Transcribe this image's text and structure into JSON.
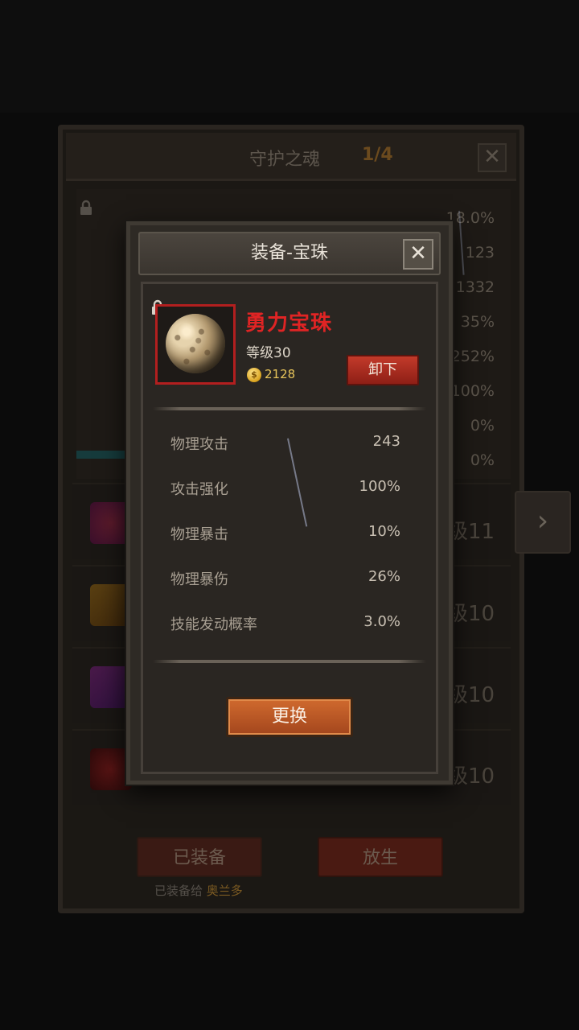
{
  "background": {
    "title": "守护之魂",
    "counter": "1/4",
    "stat_values": [
      "18.0%",
      "123",
      "1332",
      "35%",
      "252%",
      "100%",
      "0%",
      "0%"
    ],
    "slot_levels": [
      "级11",
      "级10",
      "级10",
      "级10"
    ],
    "equipped_button": "已装备",
    "release_button": "放生",
    "equipped_note": "已装备给",
    "equipped_hero": "奥兰多"
  },
  "modal": {
    "title": "装备-宝珠",
    "item": {
      "name": "勇力宝珠",
      "level": "等级30",
      "price": "2128",
      "unequip_label": "卸下"
    },
    "stats": [
      {
        "name": "物理攻击",
        "value": "243"
      },
      {
        "name": "攻击强化",
        "value": "100%"
      },
      {
        "name": "物理暴击",
        "value": "10%"
      },
      {
        "name": "物理暴伤",
        "value": "26%"
      },
      {
        "name": "技能发动概率",
        "value": "3.0%"
      }
    ],
    "replace_label": "更换"
  },
  "colors": {
    "item_name": "#e02424",
    "frame_border": "#b21f1f",
    "unequip_button": "#c23a2a",
    "replace_button": "#d06a2e",
    "price": "#e7c45a"
  },
  "icons": [
    "lock-icon",
    "close-icon",
    "coin-icon",
    "orb-icon",
    "chevron-right-icon"
  ]
}
